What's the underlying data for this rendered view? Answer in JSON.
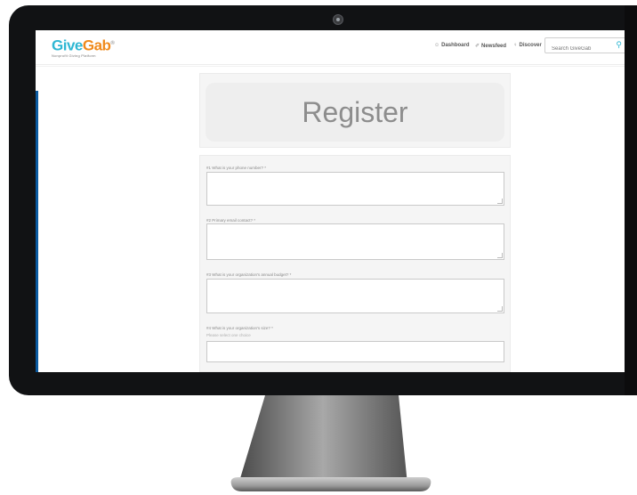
{
  "site": {
    "logo_part1": "Give",
    "logo_part2": "Gab",
    "tagline": "Nonprofit Giving Platform"
  },
  "nav": {
    "dashboard": "Dashboard",
    "newsfeed": "Newsfeed",
    "discover": "Discover",
    "search_placeholder": "Search GiveGab"
  },
  "register": {
    "title": "Register"
  },
  "form": {
    "questions": [
      {
        "label": "#1 What is your phone number? *"
      },
      {
        "label": "#2 Primary email contact? *"
      },
      {
        "label": "#3 What is your organization's annual budget? *"
      },
      {
        "label": "#4 What is your organization's size? *",
        "hint": "Please select one choice"
      }
    ]
  },
  "colors": {
    "brand_blue": "#2fb7d3",
    "brand_orange": "#f08a1c"
  }
}
